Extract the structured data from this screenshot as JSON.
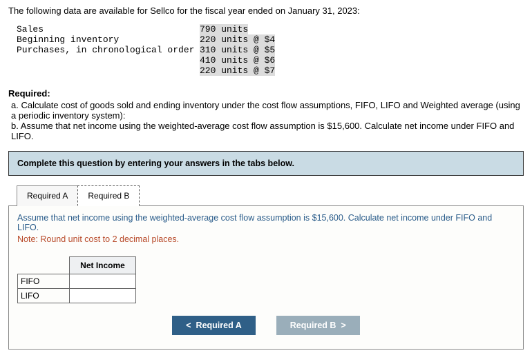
{
  "intro": "The following data are available for Sellco for the fiscal year ended on January 31, 2023:",
  "dataRows": [
    {
      "label": "Sales",
      "value": "790 units"
    },
    {
      "label": "Beginning inventory",
      "value": "220 units @ $4"
    },
    {
      "label": "Purchases, in chronological order",
      "value": "310 units @ $5"
    },
    {
      "label": "",
      "value": "410 units @ $6"
    },
    {
      "label": "",
      "value": "220 units @ $7"
    }
  ],
  "requiredTitle": "Required:",
  "requirements": {
    "a": "a. Calculate cost of goods sold and ending inventory under the cost flow assumptions, FIFO, LIFO and Weighted average (using a periodic inventory system):",
    "b": "b. Assume that net income using the weighted-average cost flow assumption is $15,600. Calculate net income under FIFO and LIFO."
  },
  "banner": "Complete this question by entering your answers in the tabs below.",
  "tabs": {
    "a": "Required A",
    "b": "Required B"
  },
  "panel": {
    "instruction": "Assume that net income using the weighted-average cost flow assumption is $15,600. Calculate net income under FIFO and LIFO.",
    "note": "Note: Round unit cost to 2 decimal places.",
    "header": "Net Income",
    "rows": {
      "fifo": "FIFO",
      "lifo": "LIFO"
    }
  },
  "nav": {
    "prev": "Required A",
    "next": "Required B"
  }
}
